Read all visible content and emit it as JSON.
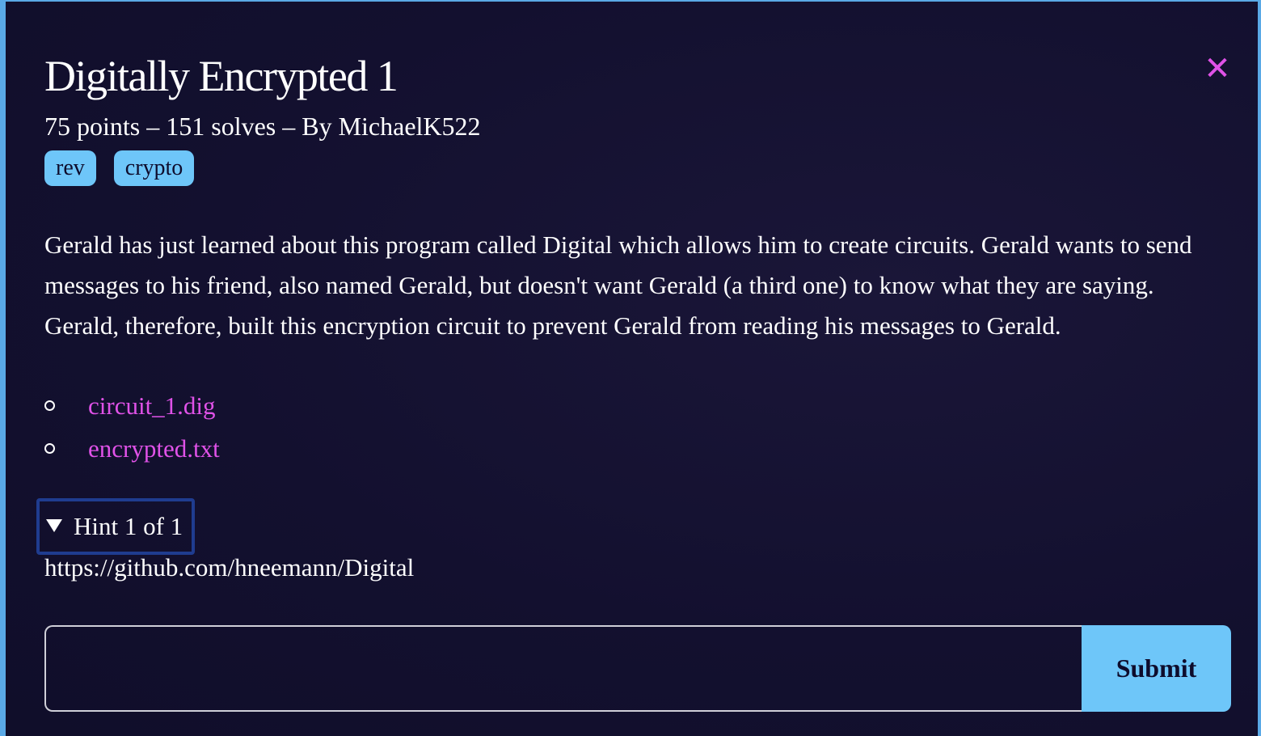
{
  "challenge": {
    "title": "Digitally Encrypted 1",
    "meta": "75 points – 151 solves – By MichaelK522",
    "tags": [
      "rev",
      "crypto"
    ],
    "description": "Gerald has just learned about this program called Digital which allows him to create circuits. Gerald wants to send messages to his friend, also named Gerald, but doesn't want Gerald (a third one) to know what they are saying. Gerald, therefore, built this encryption circuit to prevent Gerald from reading his messages to Gerald.",
    "files": [
      "circuit_1.dig",
      "encrypted.txt"
    ]
  },
  "hint": {
    "label": "Hint 1 of 1",
    "content": "https://github.com/hneemann/Digital"
  },
  "form": {
    "placeholder": "",
    "submit_label": "Submit"
  },
  "icons": {
    "close": "close-icon",
    "hint_toggle": "triangle-down-icon",
    "bullet": "circle-bullet-icon"
  },
  "colors": {
    "background": "#12102e",
    "accent": "#6ec6f9",
    "link": "#e052e8",
    "hint_border": "#1f3c8f"
  }
}
